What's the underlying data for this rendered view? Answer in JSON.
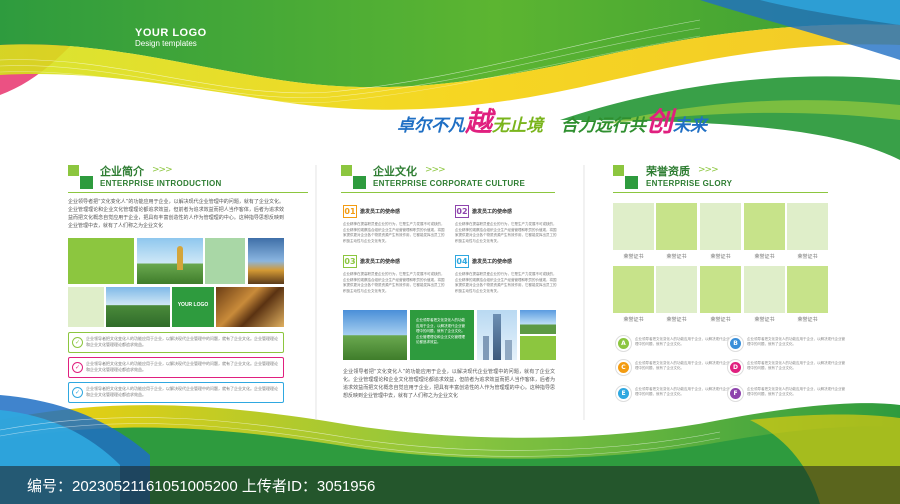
{
  "logo": {
    "title": "YOUR LOGO",
    "subtitle": "Design templates"
  },
  "slogan": {
    "part1": "卓尔不凡",
    "big1": "越",
    "part2": "无止境",
    "part3": "合力远行共",
    "big2": "创",
    "part4": "未来"
  },
  "section1": {
    "title": "企业简介",
    "chevrons": ">>>",
    "en": "ENTERPRISE INTRODUCTION",
    "paragraph": "企业领导者把“文化变化人”的功能应用于企业，以解决现代企业管理中的问题，就有了企业文化。企业管理理论和企业文化管理理论都追求效益，但前者为追求效益而把人当作客体，后者为追求效益而把文化概念自觉应用于企业，把具有丰富创造性的人作为管理理的中心。这种指导思想反映到企业管理中去，就有了人们称之为企业文化",
    "promo_logo": "YOUR LOGO",
    "rows": [
      "企业领导者把文化变化人的功能应用于企业，以解决现代企业管理中的问题，就有了企业文化。企业管理理论和企业文化管理理论都追求效益。",
      "企业领导者把文化变化人的功能应用于企业，以解决现代企业管理中的问题，就有了企业文化。企业管理理论和企业文化管理理论都追求效益。",
      "企业领导者把文化变化人的功能应用于企业，以解决现代企业管理中的问题，就有了企业文化。企业管理理论和企业文化管理理论都追求效益。"
    ]
  },
  "section2": {
    "title": "企业文化",
    "chevrons": ">>>",
    "en": "ENTERPRISE CORPORATE CULTURE",
    "items": [
      {
        "num": "01",
        "title": "激发员工的使命感",
        "text": "企业精神在提高职员爱企业的行为，它是生产力发展不可或缺的，企业精神的观察结合组织企业生产经营管理和职员的价值观，将国家提供更对企业各个物质资源产生有效作用，它都能发挥出员工的积极主动性与企业文化有关。"
      },
      {
        "num": "02",
        "title": "激发员工的使命感",
        "text": "企业精神在提高职员爱企业的行为，它是生产力发展不可或缺的，企业精神的观察结合组织企业生产经营管理和职员的价值观，将国家提供更对企业各个物质资源产生有效作用，它都能发挥出员工的积极主动性与企业文化有关。"
      },
      {
        "num": "03",
        "title": "激发员工的使命感",
        "text": "企业精神在提高职员爱企业的行为，它是生产力发展不可或缺的，企业精神的观察结合组织企业生产经营管理和职员的价值观，将国家提供更对企业各个物质资源产生有效作用，它都能发挥出员工的积极主动性与企业文化有关。"
      },
      {
        "num": "04",
        "title": "激发员工的使命感",
        "text": "企业精神在提高职员爱企业的行为，它是生产力发展不可或缺的，企业精神的观察结合组织企业生产经营管理和职员的价值观，将国家提供更对企业各个物质资源产生有效作用，它都能发挥出员工的积极主动性与企业文化有关。"
      }
    ],
    "box_text": "企业领导者把文化变化人的功能应用于企业，以解决现代企业管理中的问题，就有了企业文化。企业管理理论和企业文化管理理论都追求效益。",
    "paragraph": "企业领导者把“文化变化人”的功能应用于企业，以解决现代企业管理中的问题，就有了企业文化。企业管理理论和企业文化管理理论都追求效益，但前者为追求效益而把人当作客体，后者为追求效益而把文化概念自觉应用于企业，把具有丰富创造性的人作为管理理的中心。这种指导思想反映到企业管理中去，就有了人们称之为企业文化"
  },
  "section3": {
    "title": "荣誉资质",
    "chevrons": ">>>",
    "en": "ENTERPRISE GLORY",
    "cert_label": "荣誉证书",
    "circles": [
      {
        "letter": "A",
        "color": "#8cc63f",
        "text": "企业领导者把文化变化人的功能应用于企业，以解决现代企业管理中的问题，就有了企业文化。"
      },
      {
        "letter": "B",
        "color": "#3a8fd9",
        "text": "企业领导者把文化变化人的功能应用于企业，以解决现代企业管理中的问题，就有了企业文化。"
      },
      {
        "letter": "C",
        "color": "#f39c12",
        "text": "企业领导者把文化变化人的功能应用于企业，以解决现代企业管理中的问题，就有了企业文化。"
      },
      {
        "letter": "D",
        "color": "#e0207f",
        "text": "企业领导者把文化变化人的功能应用于企业，以解决现代企业管理中的问题，就有了企业文化。"
      },
      {
        "letter": "E",
        "color": "#2fa8e0",
        "text": "企业领导者把文化变化人的功能应用于企业，以解决现代企业管理中的问题，就有了企业文化。"
      },
      {
        "letter": "F",
        "color": "#8e44ad",
        "text": "企业领导者把文化变化人的功能应用于企业，以解决现代企业管理中的问题，就有了企业文化。"
      }
    ]
  },
  "colors": {
    "green_dark": "#2e9b3e",
    "green_light": "#8cc63f",
    "yellow": "#f5d20a",
    "blue": "#1f6fc4",
    "pink": "#e0207f"
  },
  "footer": {
    "text": "编号：20230521161051005200   上传者ID：3051956"
  }
}
